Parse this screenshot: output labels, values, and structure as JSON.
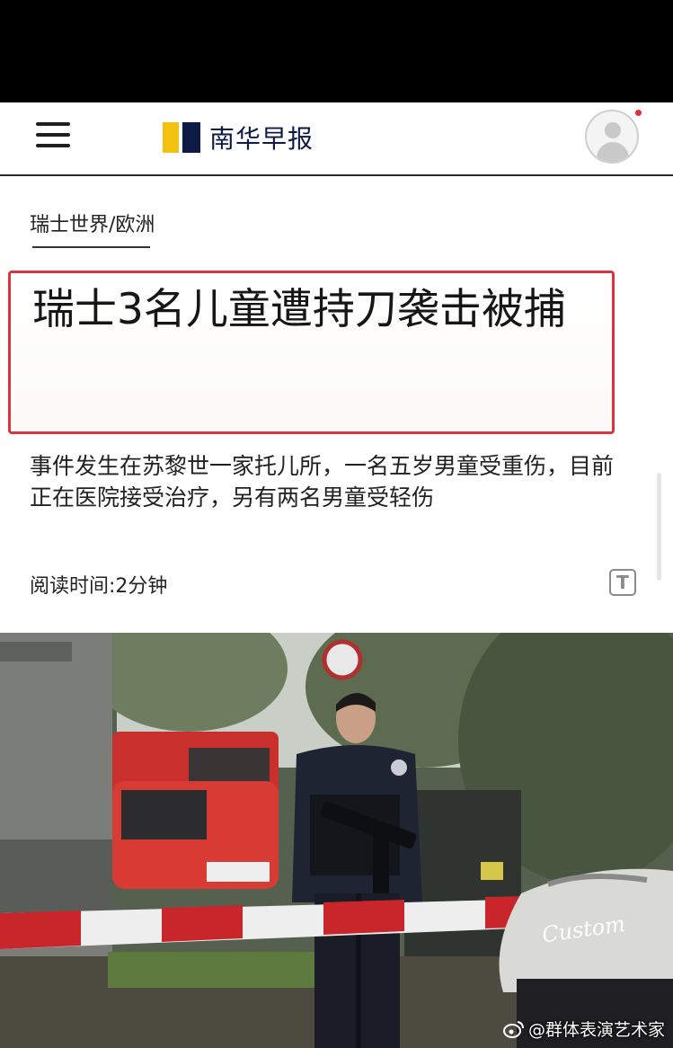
{
  "header": {
    "menu_icon": "hamburger-menu-icon",
    "logo_text": "南华早报",
    "logo_colors": {
      "yellow": "#f3c10f",
      "navy": "#0c1a45"
    },
    "avatar_icon": "user-avatar-icon",
    "notification_color": "#e0303a"
  },
  "article": {
    "category": "瑞士世界/欧洲",
    "headline": "瑞士3名儿童遭持刀袭击被捕",
    "summary": "事件发生在苏黎世一家托儿所，一名五岁男童受重伤，目前正在医院接受治疗，另有两名男童受轻伤",
    "reading_time": "阅读时间:2分钟",
    "text_size_icon": "text-size-icon",
    "text_size_glyph": "T",
    "highlight_color": "#d9343f"
  },
  "photo": {
    "sign_text": "Custom",
    "watermark": "@群体表演艺术家",
    "watermark_icon": "weibo-icon"
  }
}
